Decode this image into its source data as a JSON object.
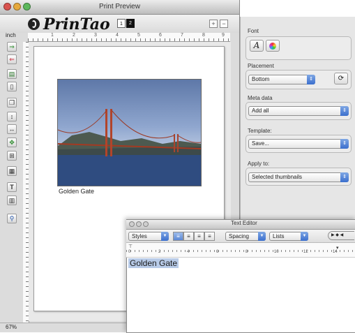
{
  "print_preview": {
    "title": "Print Preview",
    "app_name": "PrinTao",
    "pages": [
      "1",
      "2"
    ],
    "zoom_in": "+",
    "zoom_out": "−",
    "ruler_unit": "inch",
    "ruler_numbers": [
      "1",
      "2",
      "3",
      "4",
      "5",
      "6",
      "7",
      "8",
      "9"
    ],
    "zoom_level": "67%",
    "caption": "Golden Gate"
  },
  "inspector": {
    "font_label": "Font",
    "font_icon": "A",
    "placement_label": "Placement",
    "placement_value": "Bottom",
    "meta_label": "Meta data",
    "meta_value": "Add all",
    "template_label": "Template:",
    "template_value": "Save...",
    "apply_label": "Apply to:",
    "apply_value": "Selected thumbnails"
  },
  "text_editor": {
    "title": "Text Editor",
    "styles": "Styles",
    "spacing": "Spacing",
    "lists": "Lists",
    "ruler_numbers": [
      "0",
      "2",
      "4",
      "6",
      "8",
      "10",
      "12",
      "14"
    ],
    "content": "Golden Gate"
  },
  "colors": {
    "selection": "#b8cbe8",
    "popup_arrow": "#3b6fce",
    "close": "#d9534f",
    "minimize": "#e6a93c",
    "zoom": "#5cb85c"
  }
}
